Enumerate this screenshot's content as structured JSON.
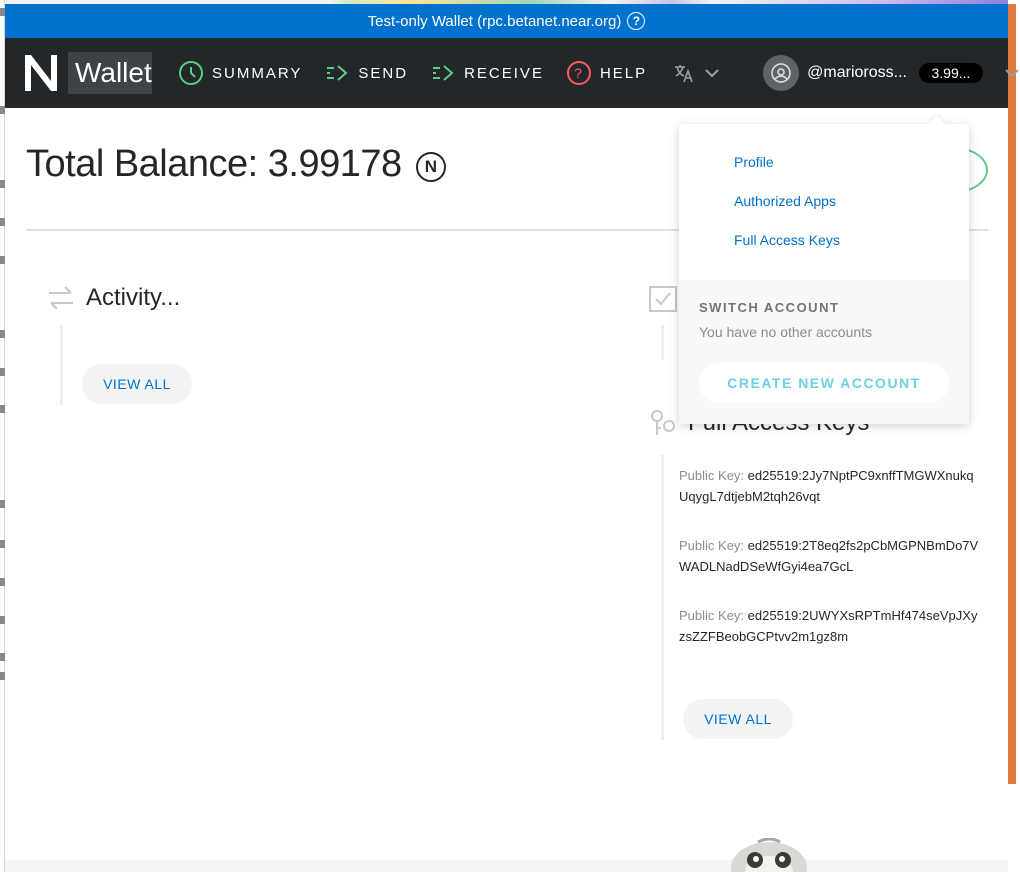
{
  "banner": {
    "text": "Test-only Wallet (rpc.betanet.near.org)",
    "help_icon": "help-icon"
  },
  "nav": {
    "logo_text": "Wallet",
    "items": [
      {
        "label": "SUMMARY",
        "icon": "clock-icon"
      },
      {
        "label": "SEND",
        "icon": "send-icon"
      },
      {
        "label": "RECEIVE",
        "icon": "receive-icon"
      },
      {
        "label": "HELP",
        "icon": "help-icon"
      }
    ],
    "language_icon": "translate-icon",
    "account": {
      "name": "@marioross...",
      "balance": "3.99..."
    }
  },
  "main": {
    "total_balance": "Total Balance: 3.99178",
    "near_symbol": "N",
    "activity_title": "Activity...",
    "activity_view_all": "VIEW ALL",
    "keys_title": "Full Access Keys",
    "keys_view_all": "VIEW ALL",
    "key_label": "Public Key:",
    "keys": [
      "ed25519:2Jy7NptPC9xnffTMGWXnukqUqygL7dtjebM2tqh26vqt",
      "ed25519:2T8eq2fs2pCbMGPNBmDo7VWADLNadDSeWfGyi4ea7GcL",
      "ed25519:2UWYXsRPTmHf474seVpJXyzsZZFBeobGCPtvv2m1gz8m"
    ]
  },
  "dropdown": {
    "links": [
      "Profile",
      "Authorized Apps",
      "Full Access Keys"
    ],
    "switch_title": "SWITCH ACCOUNT",
    "switch_sub": "You have no other accounts",
    "create_button": "CREATE NEW ACCOUNT"
  },
  "colors": {
    "banner": "#0072ce",
    "nav": "#24272a",
    "accent_green": "#5ace84",
    "link": "#0072ce",
    "create": "#6ad1e3",
    "help_red": "#ff585d"
  }
}
